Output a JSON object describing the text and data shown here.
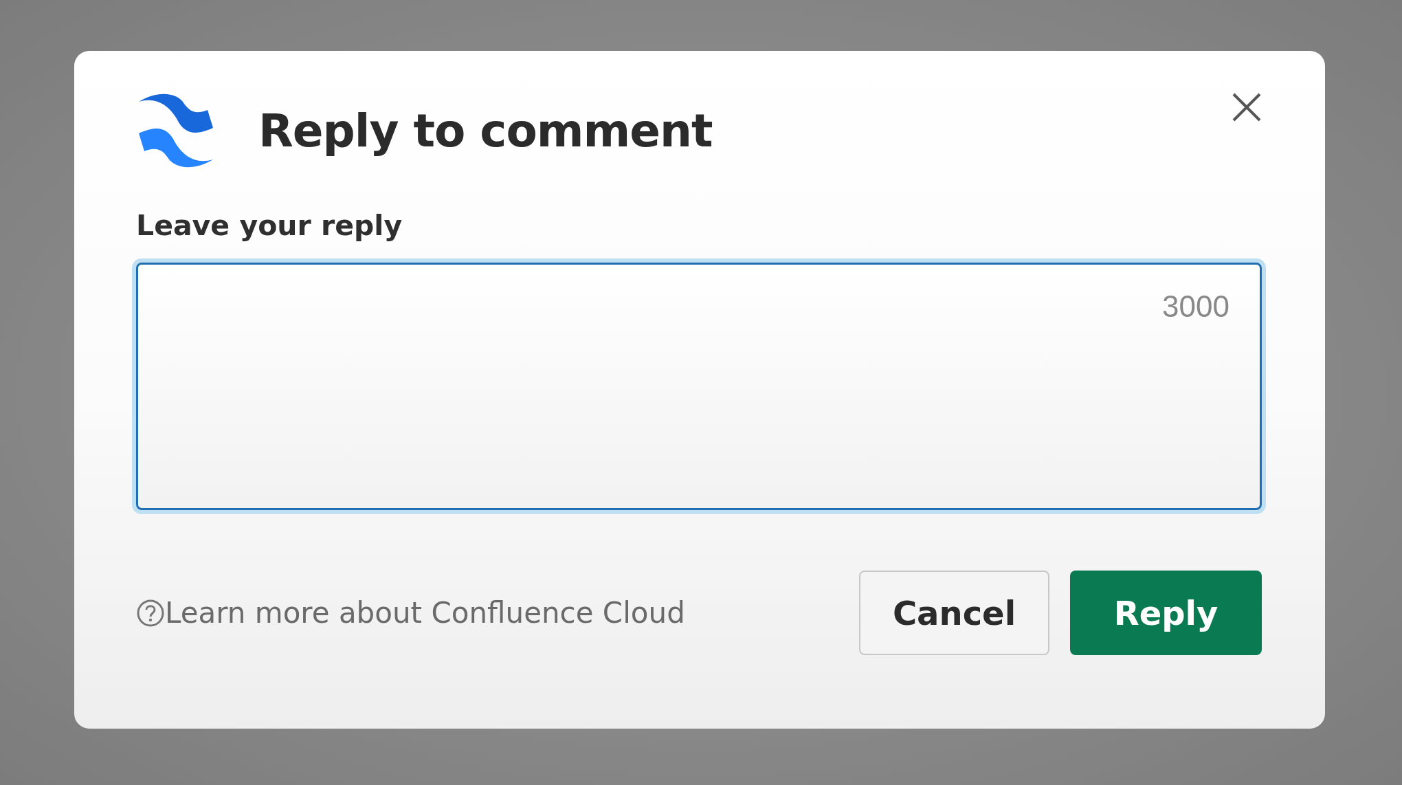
{
  "dialog": {
    "title": "Reply to comment"
  },
  "field": {
    "label": "Leave your reply",
    "counter": "3000"
  },
  "footer": {
    "help_link": "Learn more about Confluence Cloud"
  },
  "buttons": [
    {
      "label": "Cancel",
      "kind": "secondary"
    },
    {
      "label": "Reply",
      "kind": "primary"
    }
  ]
}
